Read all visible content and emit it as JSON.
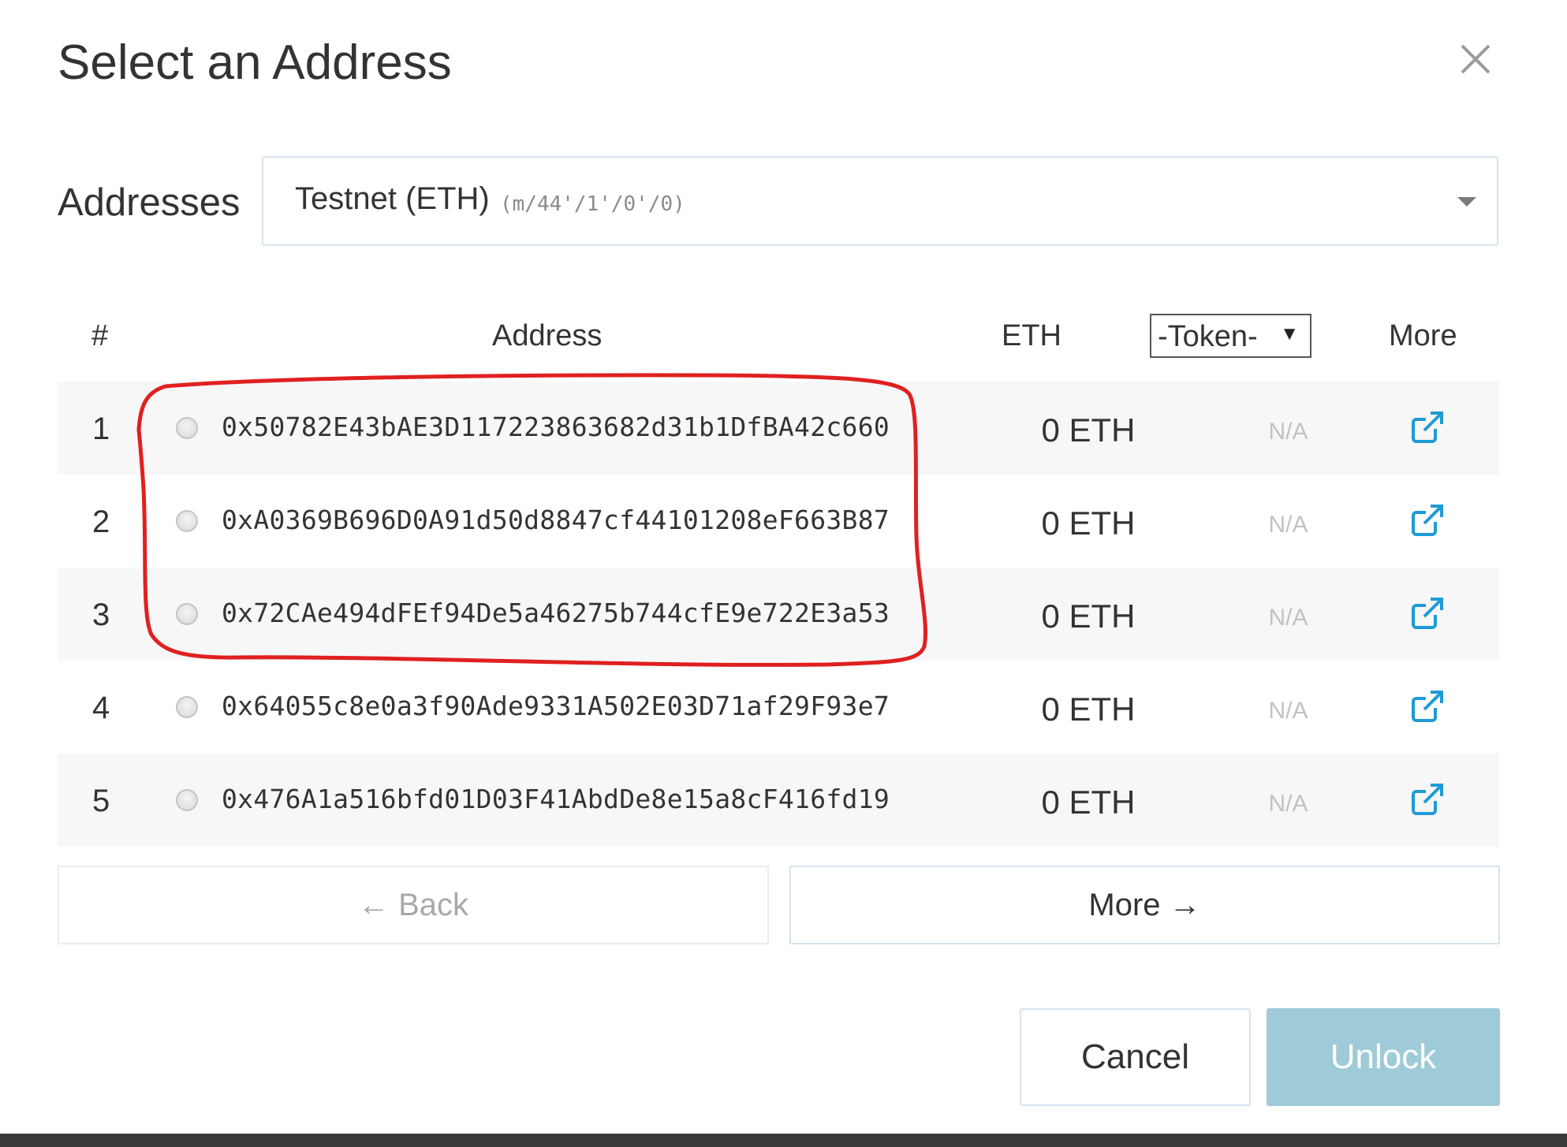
{
  "modal": {
    "title": "Select an Address",
    "close_icon": "close-icon"
  },
  "addresses": {
    "label": "Addresses",
    "selected_network": "Testnet (ETH)",
    "selected_path": "(m/44'/1'/0'/0)"
  },
  "table": {
    "headers": {
      "num": "#",
      "address": "Address",
      "eth": "ETH",
      "token_select": "-Token-",
      "more": "More"
    },
    "rows": [
      {
        "num": "1",
        "address": "0x50782E43bAE3D117223863682d31b1DfBA42c660",
        "eth": "0 ETH",
        "token": "N/A"
      },
      {
        "num": "2",
        "address": "0xA0369B696D0A91d50d8847cf44101208eF663B87",
        "eth": "0 ETH",
        "token": "N/A"
      },
      {
        "num": "3",
        "address": "0x72CAe494dFEf94De5a46275b744cfE9e722E3a53",
        "eth": "0 ETH",
        "token": "N/A"
      },
      {
        "num": "4",
        "address": "0x64055c8e0a3f90Ade9331A502E03D71af29F93e7",
        "eth": "0 ETH",
        "token": "N/A"
      },
      {
        "num": "5",
        "address": "0x476A1a516bfd01D03F41AbdDe8e15a8cF416fd19",
        "eth": "0 ETH",
        "token": "N/A"
      }
    ]
  },
  "pagination": {
    "back_label": "← Back",
    "more_label": "More →"
  },
  "footer": {
    "cancel_label": "Cancel",
    "unlock_label": "Unlock"
  },
  "colors": {
    "accent": "#1e9bd7",
    "unlock_disabled": "#9fcbd8",
    "annotation": "#e02020"
  }
}
